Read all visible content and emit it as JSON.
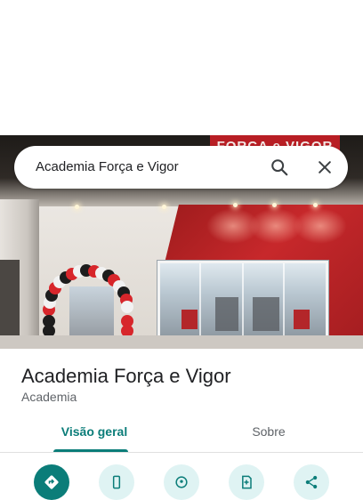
{
  "search": {
    "query": "Academia Força e Vigor",
    "search_icon": "search-icon",
    "close_icon": "close-icon"
  },
  "photo": {
    "sign_text": "FORÇA e VIGOR"
  },
  "place": {
    "name": "Academia Força e Vigor",
    "category": "Academia"
  },
  "tabs": [
    {
      "label": "Visão geral",
      "selected": true
    },
    {
      "label": "Sobre",
      "selected": false
    }
  ],
  "actions": [
    {
      "icon": "directions-icon",
      "style": "primary"
    },
    {
      "icon": "phone-icon",
      "style": "secondary"
    },
    {
      "icon": "location-icon",
      "style": "secondary"
    },
    {
      "icon": "save-icon",
      "style": "secondary"
    },
    {
      "icon": "share-icon",
      "style": "secondary"
    }
  ],
  "colors": {
    "accent": "#0b7d79",
    "accent_light": "#dff3f3",
    "title_text": "#202124",
    "secondary_text": "#5f6368"
  }
}
